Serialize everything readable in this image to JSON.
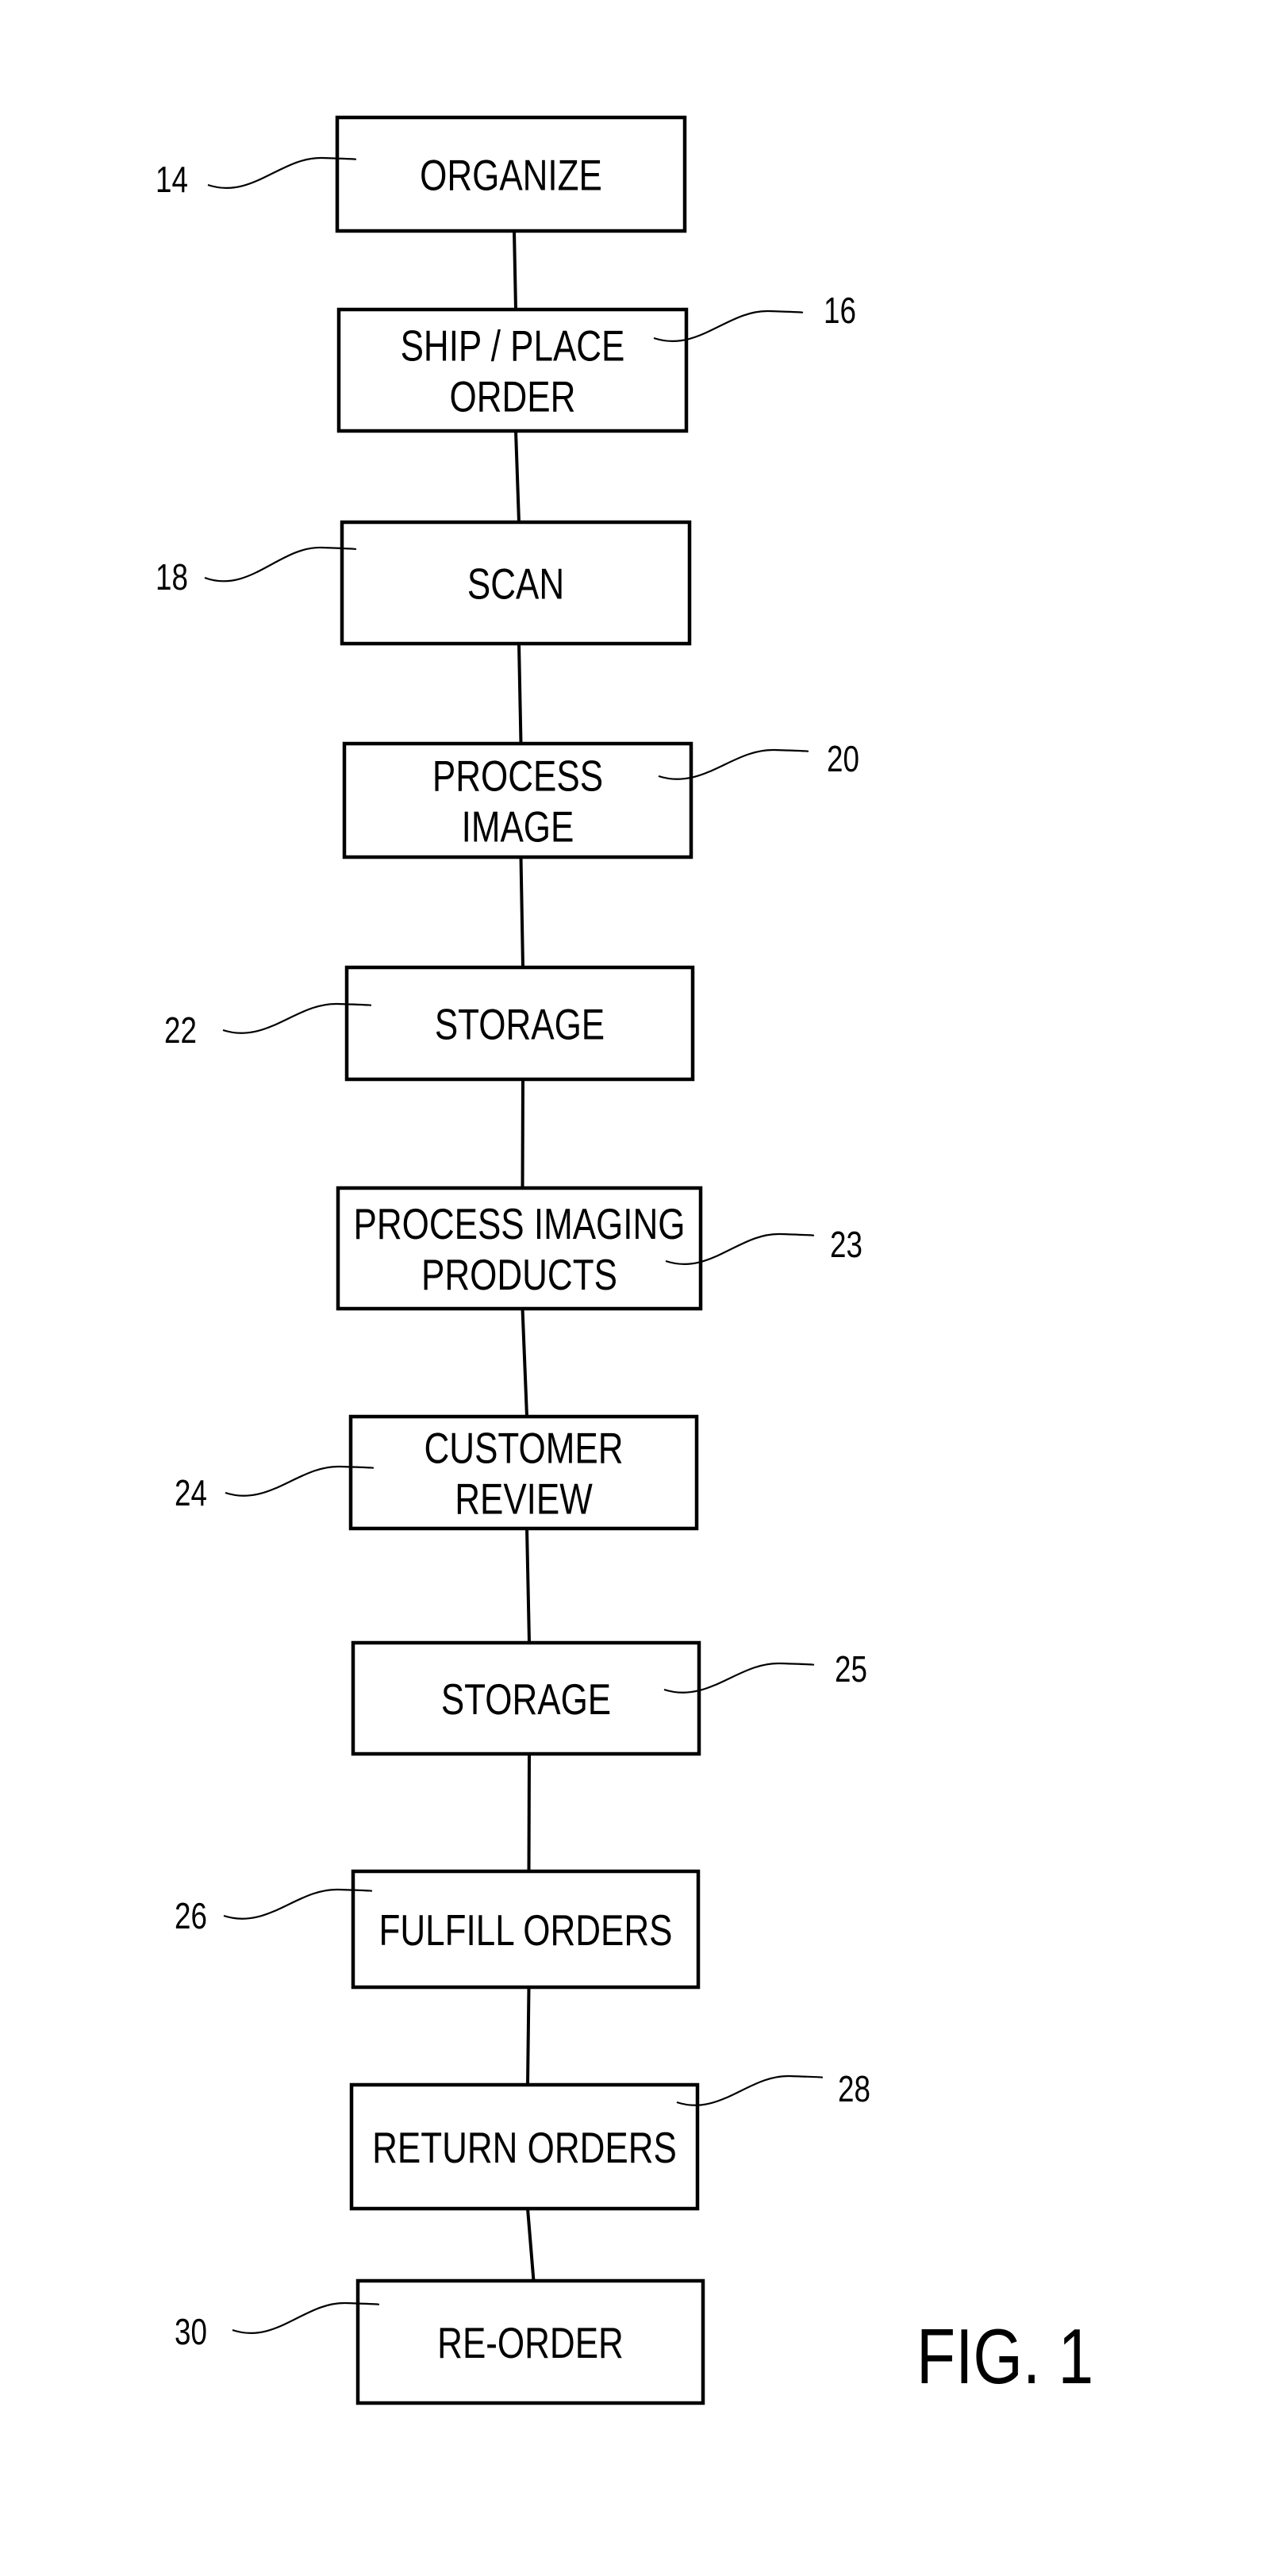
{
  "figure": {
    "label": "FIG. 1",
    "steps": [
      {
        "ref": "14",
        "lines": [
          "ORGANIZE"
        ]
      },
      {
        "ref": "16",
        "lines": [
          "SHIP / PLACE",
          "ORDER"
        ]
      },
      {
        "ref": "18",
        "lines": [
          "SCAN"
        ]
      },
      {
        "ref": "20",
        "lines": [
          "PROCESS",
          "IMAGE"
        ]
      },
      {
        "ref": "22",
        "lines": [
          "STORAGE"
        ]
      },
      {
        "ref": "23",
        "lines": [
          "PROCESS IMAGING",
          "PRODUCTS"
        ]
      },
      {
        "ref": "24",
        "lines": [
          "CUSTOMER",
          "REVIEW"
        ]
      },
      {
        "ref": "25",
        "lines": [
          "STORAGE"
        ]
      },
      {
        "ref": "26",
        "lines": [
          "FULFILL ORDERS"
        ]
      },
      {
        "ref": "28",
        "lines": [
          "RETURN ORDERS"
        ]
      },
      {
        "ref": "30",
        "lines": [
          "RE-ORDER"
        ]
      }
    ]
  }
}
